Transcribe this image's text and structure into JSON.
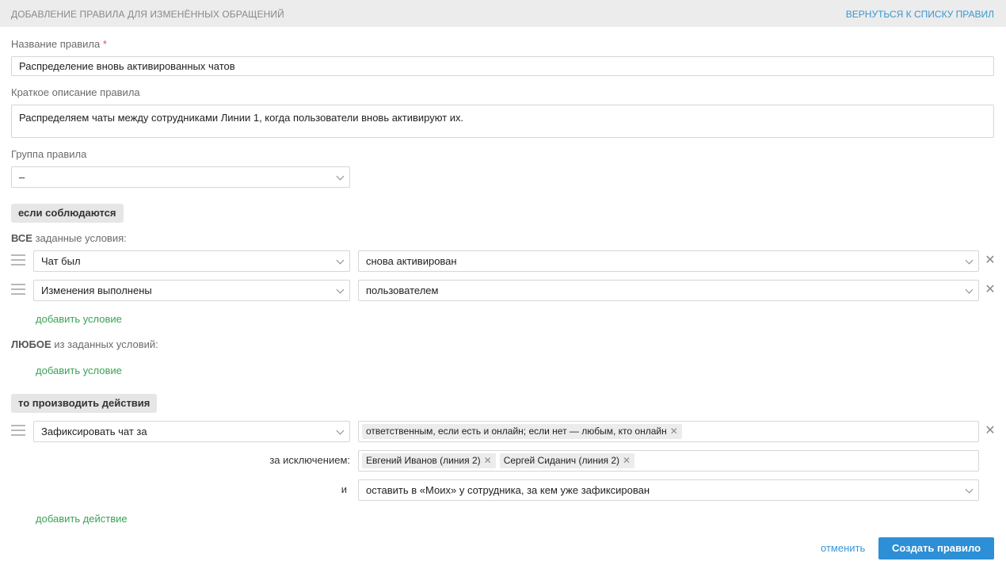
{
  "header": {
    "title": "ДОБАВЛЕНИЕ ПРАВИЛА ДЛЯ ИЗМЕНЁННЫХ ОБРАЩЕНИЙ",
    "back_link": "ВЕРНУТЬСЯ К СПИСКУ ПРАВИЛ"
  },
  "form": {
    "name_label": "Название правила",
    "name_required_mark": "*",
    "name_value": "Распределение вновь активированных чатов",
    "description_label": "Краткое описание правила",
    "description_value": "Распределяем чаты между сотрудниками Линии 1, когда пользователи вновь активируют их.",
    "group_label": "Группа правила",
    "group_value": "–"
  },
  "conditions": {
    "section_label": "если соблюдаются",
    "all_prefix": "ВСЕ",
    "all_suffix": " заданные условия:",
    "all_rows": [
      {
        "field": "Чат был",
        "value": "снова активирован"
      },
      {
        "field": "Изменения выполнены",
        "value": "пользователем"
      }
    ],
    "add_condition_label": "добавить условие",
    "any_prefix": "ЛЮБОЕ",
    "any_suffix": " из заданных условий:",
    "add_condition_any_label": "добавить условие"
  },
  "actions": {
    "section_label": "то производить действия",
    "action_field": "Зафиксировать чат за",
    "action_tags": [
      "ответственным, если есть и онлайн; если нет — любым, кто онлайн"
    ],
    "except_label": "за исключением:",
    "except_tags": [
      "Евгений Иванов (линия 2)",
      "Сергей Сиданич (линия 2)"
    ],
    "and_label": "и",
    "and_value": "оставить в «Моих» у сотрудника, за кем уже зафиксирован",
    "add_action_label": "добавить действие"
  },
  "footer": {
    "cancel_label": "отменить",
    "create_label": "Создать правило"
  },
  "icons": {
    "remove": "close-icon",
    "drag": "drag-handle-icon",
    "chevron": "chevron-down-icon",
    "tag_remove": "tag-remove-icon"
  },
  "colors": {
    "link_blue": "#3a96d2",
    "add_green": "#3aa355",
    "primary_button": "#2d8fd5",
    "required_red": "#d9534f",
    "header_bg": "#ececec"
  }
}
